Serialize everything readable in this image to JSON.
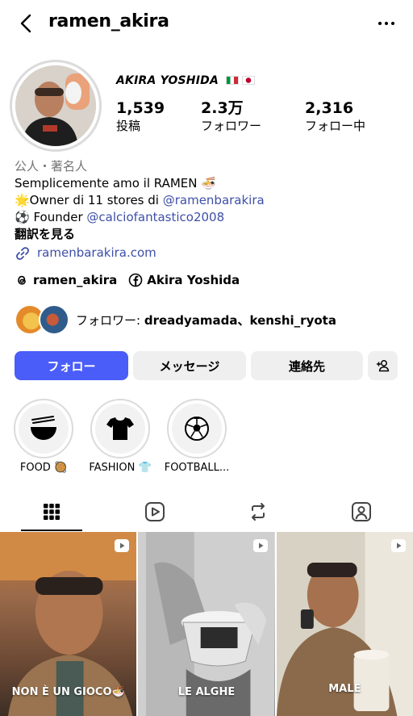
{
  "header": {
    "username": "ramen_akira",
    "back_icon": "chevron-left-icon",
    "more_icon": "more-horizontal-icon"
  },
  "profile": {
    "display_name": "AKIRA YOSHIDA",
    "flags": [
      "🇮🇹",
      "🇯🇵"
    ],
    "stats": [
      {
        "value": "1,539",
        "label": "投稿"
      },
      {
        "value": "2.3万",
        "label": "フォロワー"
      },
      {
        "value": "2,316",
        "label": "フォロー中"
      }
    ],
    "category": "公人・著名人",
    "bio": {
      "line1": "Semplicemente amo il RAMEN 🍜",
      "line2_prefix": "🌟Owner di 11 stores di ",
      "line2_mention": "@ramenbarakira",
      "line3_prefix": "⚽ Founder ",
      "line3_mention": "@calciofantastico2008",
      "translate": "翻訳を見る",
      "url": "ramenbarakira.com"
    },
    "threads_handle": "ramen_akira",
    "facebook_name": "Akira Yoshida",
    "followed_by_prefix": "フォロワー: ",
    "followed_by_names": "dreadyamada、kenshi_ryota"
  },
  "buttons": {
    "follow": "フォロー",
    "message": "メッセージ",
    "contact": "連絡先"
  },
  "highlights": [
    {
      "label": "FOOD 🥘",
      "icon": "ramen-bowl-icon"
    },
    {
      "label": "FASHION 👕",
      "icon": "tshirt-icon"
    },
    {
      "label": "FOOTBALL...",
      "icon": "soccer-ball-icon"
    }
  ],
  "tabs": [
    "grid-icon",
    "reels-icon",
    "reposts-icon",
    "tagged-icon"
  ],
  "posts": [
    {
      "caption": "NON È UN GIOCO🍜",
      "type": "reel"
    },
    {
      "caption": "LE ALGHE",
      "type": "reel"
    },
    {
      "caption": "MALE",
      "type": "reel"
    }
  ],
  "colors": {
    "follow_button": "#4a5df9",
    "secondary_button": "#efefef",
    "link": "#3d4fa8"
  }
}
